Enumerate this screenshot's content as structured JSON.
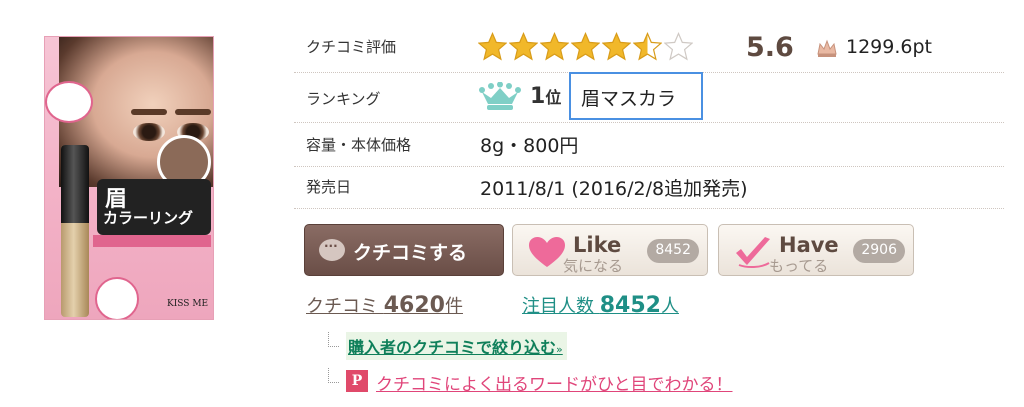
{
  "product": {
    "brand_text": "KISS ME",
    "package_title_1": "眉",
    "package_title_2": "カラーリング"
  },
  "rows": {
    "rating": {
      "label": "クチコミ評価",
      "score": "5.6",
      "stars_filled": 5.5,
      "stars_total": 7,
      "points": "1299.6pt"
    },
    "ranking": {
      "label": "ランキング",
      "rank_num": "1",
      "rank_suffix": "位",
      "category": "眉マスカラ"
    },
    "capacity": {
      "label": "容量・本体価格",
      "value": "8g・800円"
    },
    "release": {
      "label": "発売日",
      "value": "2011/8/1 (2016/2/8追加発売)"
    }
  },
  "buttons": {
    "review": {
      "label": "クチコミする"
    },
    "like": {
      "main": "Like",
      "sub": "気になる",
      "count": "8452"
    },
    "have": {
      "main": "Have",
      "sub": "もってる",
      "count": "2906"
    }
  },
  "counts": {
    "reviews": {
      "prefix": "クチコミ ",
      "number": "4620",
      "suffix": "件"
    },
    "watchers": {
      "prefix": "注目人数 ",
      "number": "8452",
      "suffix": "人"
    }
  },
  "links": {
    "buyer_reviews": "購入者のクチコミで絞り込む",
    "buyer_reviews_arrow": "»",
    "word_cloud": "クチコミによく出るワードがひと目でわかる！"
  },
  "colors": {
    "star_gold": "#f1b82a",
    "star_empty": "#cfc9c4",
    "accent_teal": "#1f8f86",
    "accent_pink": "#e0457a",
    "focus_blue": "#4a90e2"
  },
  "icons": {
    "rating": "star-icon",
    "points": "crown-icon",
    "ranking": "teal-crown-icon",
    "like": "heart-icon",
    "have": "check-icon",
    "review": "speech-bubble-icon"
  }
}
